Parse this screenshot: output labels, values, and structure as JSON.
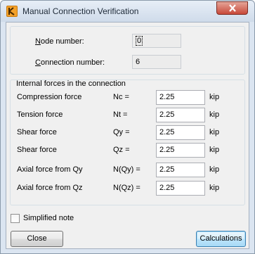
{
  "window": {
    "title": "Manual Connection Verification"
  },
  "node": {
    "label": "Node number:",
    "underline": "N",
    "rest": "ode number:",
    "value": "0"
  },
  "connection": {
    "label": "Connection number:",
    "underline": "C",
    "rest": "onnection number:",
    "value": "6"
  },
  "forces_group": {
    "title": "Internal forces in the connection"
  },
  "forces": [
    {
      "name": "Compression force",
      "symbol": "Nc =",
      "value": "2.25",
      "unit": "kip"
    },
    {
      "name": "Tension force",
      "symbol": "Nt =",
      "value": "2.25",
      "unit": "kip"
    },
    {
      "name": "Shear force",
      "symbol": "Qy =",
      "value": "2.25",
      "unit": "kip"
    },
    {
      "name": "Shear force",
      "symbol": "Qz =",
      "value": "2.25",
      "unit": "kip"
    },
    {
      "name": "Axial force from Qy",
      "symbol": "N(Qy) =",
      "value": "2.25",
      "unit": "kip"
    },
    {
      "name": "Axial force from Qz",
      "symbol": "N(Qz) =",
      "value": "2.25",
      "unit": "kip"
    }
  ],
  "simplified_note": {
    "label": "Simplified note",
    "checked": false
  },
  "buttons": {
    "close": "Close",
    "calculations": "Calculations"
  },
  "icons": {
    "app": "app-logo-icon",
    "close": "close-icon"
  }
}
